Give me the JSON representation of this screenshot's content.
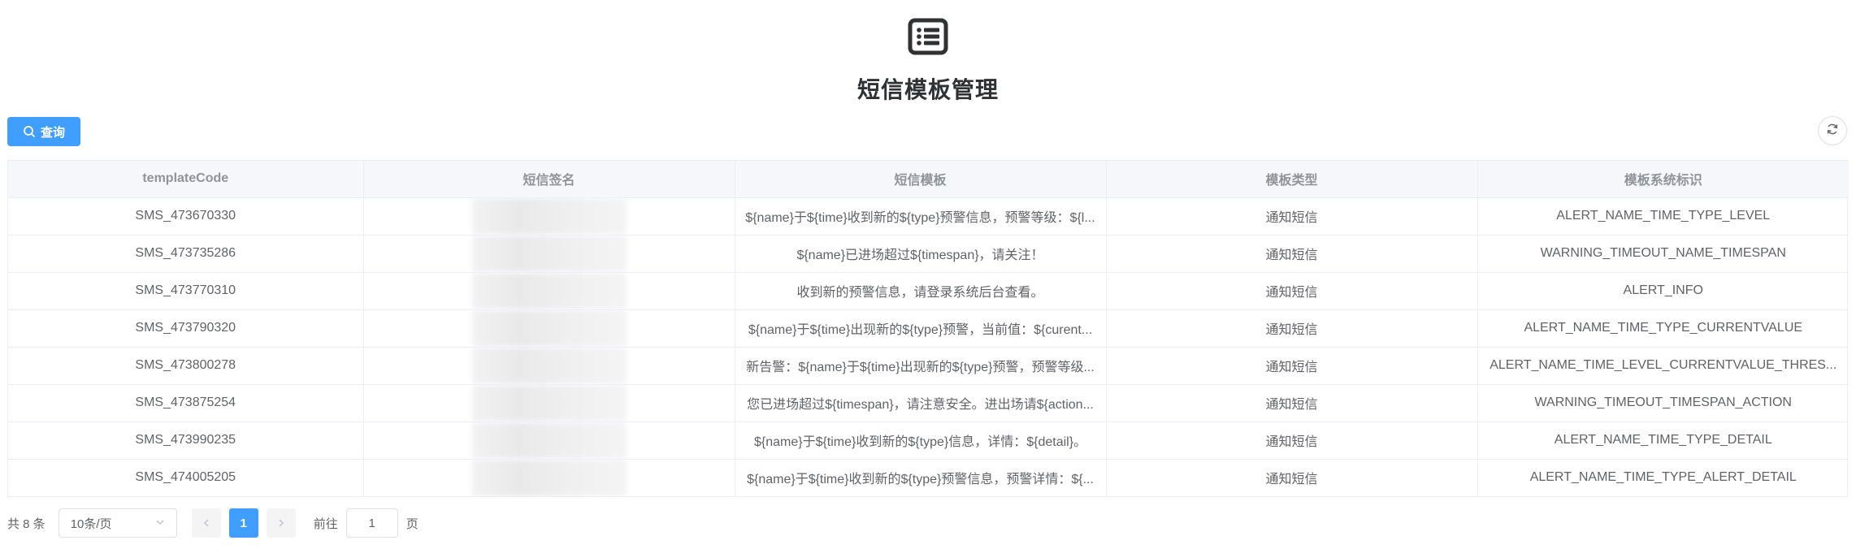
{
  "header": {
    "icon": "list-icon",
    "title": "短信模板管理"
  },
  "toolbar": {
    "query_label": "查询",
    "query_icon": "search-icon",
    "refresh_icon": "refresh-icon"
  },
  "table": {
    "columns": [
      "templateCode",
      "短信签名",
      "短信模板",
      "模板类型",
      "模板系统标识"
    ],
    "rows": [
      {
        "code": "SMS_473670330",
        "signature": "",
        "template": "${name}于${time}收到新的${type}预警信息，预警等级：${l...",
        "type": "通知短信",
        "system_id": "ALERT_NAME_TIME_TYPE_LEVEL"
      },
      {
        "code": "SMS_473735286",
        "signature": "",
        "template": "${name}已进场超过${timespan}，请关注！",
        "type": "通知短信",
        "system_id": "WARNING_TIMEOUT_NAME_TIMESPAN"
      },
      {
        "code": "SMS_473770310",
        "signature": "",
        "template": "收到新的预警信息，请登录系统后台查看。",
        "type": "通知短信",
        "system_id": "ALERT_INFO"
      },
      {
        "code": "SMS_473790320",
        "signature": "",
        "template": "${name}于${time}出现新的${type}预警，当前值：${curent...",
        "type": "通知短信",
        "system_id": "ALERT_NAME_TIME_TYPE_CURRENTVALUE"
      },
      {
        "code": "SMS_473800278",
        "signature": "",
        "template": "新告警：${name}于${time}出现新的${type}预警，预警等级...",
        "type": "通知短信",
        "system_id": "ALERT_NAME_TIME_LEVEL_CURRENTVALUE_THRES..."
      },
      {
        "code": "SMS_473875254",
        "signature": "",
        "template": "您已进场超过${timespan}，请注意安全。进出场请${action...",
        "type": "通知短信",
        "system_id": "WARNING_TIMEOUT_TIMESPAN_ACTION"
      },
      {
        "code": "SMS_473990235",
        "signature": "",
        "template": "${name}于${time}收到新的${type}信息，详情：${detail}。",
        "type": "通知短信",
        "system_id": "ALERT_NAME_TIME_TYPE_DETAIL"
      },
      {
        "code": "SMS_474005205",
        "signature": "",
        "template": "${name}于${time}收到新的${type}预警信息，预警详情：${...",
        "type": "通知短信",
        "system_id": "ALERT_NAME_TIME_TYPE_ALERT_DETAIL"
      }
    ]
  },
  "pagination": {
    "total_label": "共 8 条",
    "page_size": "10条/页",
    "current_page": "1",
    "goto_label": "前往",
    "goto_value": "1",
    "goto_suffix": "页"
  },
  "colors": {
    "primary": "#409eff",
    "header_bg": "#f5f7fa",
    "border": "#ebeef5"
  }
}
